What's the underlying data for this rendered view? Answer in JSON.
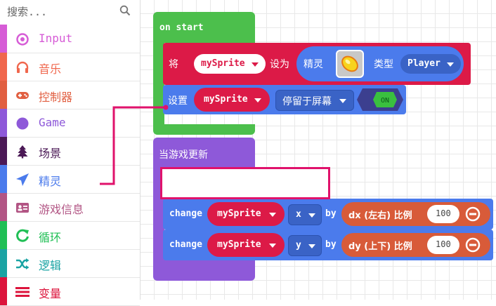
{
  "search": {
    "placeholder": "搜索..."
  },
  "categories": [
    {
      "label": "Input",
      "color": "#d65cd6",
      "icon": "target-icon"
    },
    {
      "label": "音乐",
      "color": "#f0674d",
      "icon": "headphones-icon"
    },
    {
      "label": "控制器",
      "color": "#e15f41",
      "icon": "gamepad-icon"
    },
    {
      "label": "Game",
      "color": "#8e59d9",
      "icon": "circle-icon"
    },
    {
      "label": "场景",
      "color": "#4b1956",
      "icon": "tree-icon"
    },
    {
      "label": "精灵",
      "color": "#4b7bec",
      "icon": "paper-plane-icon"
    },
    {
      "label": "游戏信息",
      "color": "#b25584",
      "icon": "id-card-icon"
    },
    {
      "label": "循环",
      "color": "#20bf55",
      "icon": "refresh-icon"
    },
    {
      "label": "逻辑",
      "color": "#1aa3a3",
      "icon": "shuffle-icon"
    },
    {
      "label": "变量",
      "color": "#dc143c",
      "icon": "bars-icon"
    }
  ],
  "on_start": {
    "hat_label": "on start",
    "set_block": {
      "prefix": "将",
      "variable": "mySprite",
      "middle": "设为",
      "sprite_label": "精灵",
      "kind_label": "类型",
      "kind_value": "Player"
    },
    "stay_block": {
      "prefix": "设置",
      "variable": "mySprite",
      "option": "停留于屏幕",
      "toggle": "ON"
    }
  },
  "on_update": {
    "hat_label": "当游戏更新",
    "change_x": {
      "keyword": "change",
      "variable": "mySprite",
      "axis": "x",
      "by": "by",
      "source": "dx (左右) 比例",
      "amount": "100"
    },
    "change_y": {
      "keyword": "change",
      "variable": "mySprite",
      "axis": "y",
      "by": "by",
      "source": "dy (上下) 比例",
      "amount": "100"
    }
  },
  "colors": {
    "loops": "#4cbf4c",
    "variables": "#dc1a47",
    "sprites": "#4b7bec",
    "game": "#8e59d9",
    "math": "#d85b39",
    "highlight": "#e0126b"
  }
}
